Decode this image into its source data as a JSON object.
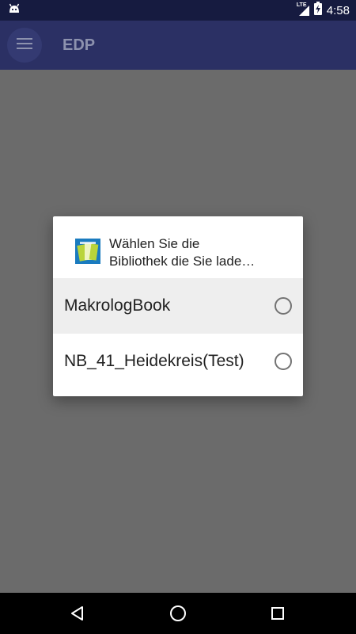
{
  "status_bar": {
    "time": "4:58",
    "network": "LTE",
    "icons": [
      "android-notification-icon",
      "signal-icon",
      "battery-charging-icon"
    ]
  },
  "app_bar": {
    "title": "EDP",
    "menu_icon": "hamburger-menu-icon"
  },
  "dialog": {
    "title_line1": "Wählen Sie die",
    "title_line2": "Bibliothek die Sie lade…",
    "icon": "library-app-icon",
    "options": [
      {
        "label": "MakrologBook",
        "selected": false,
        "highlighted": true
      },
      {
        "label": "NB_41_Heidekreis(Test)",
        "selected": false,
        "highlighted": false
      }
    ]
  },
  "nav_bar": {
    "buttons": [
      "back-icon",
      "home-icon",
      "recents-icon"
    ]
  },
  "colors": {
    "status_bar": "#161b40",
    "app_bar": "#2b3064",
    "scrim": "#6b6b6b",
    "dialog_bg": "#ffffff",
    "highlight": "#eeeeee"
  }
}
